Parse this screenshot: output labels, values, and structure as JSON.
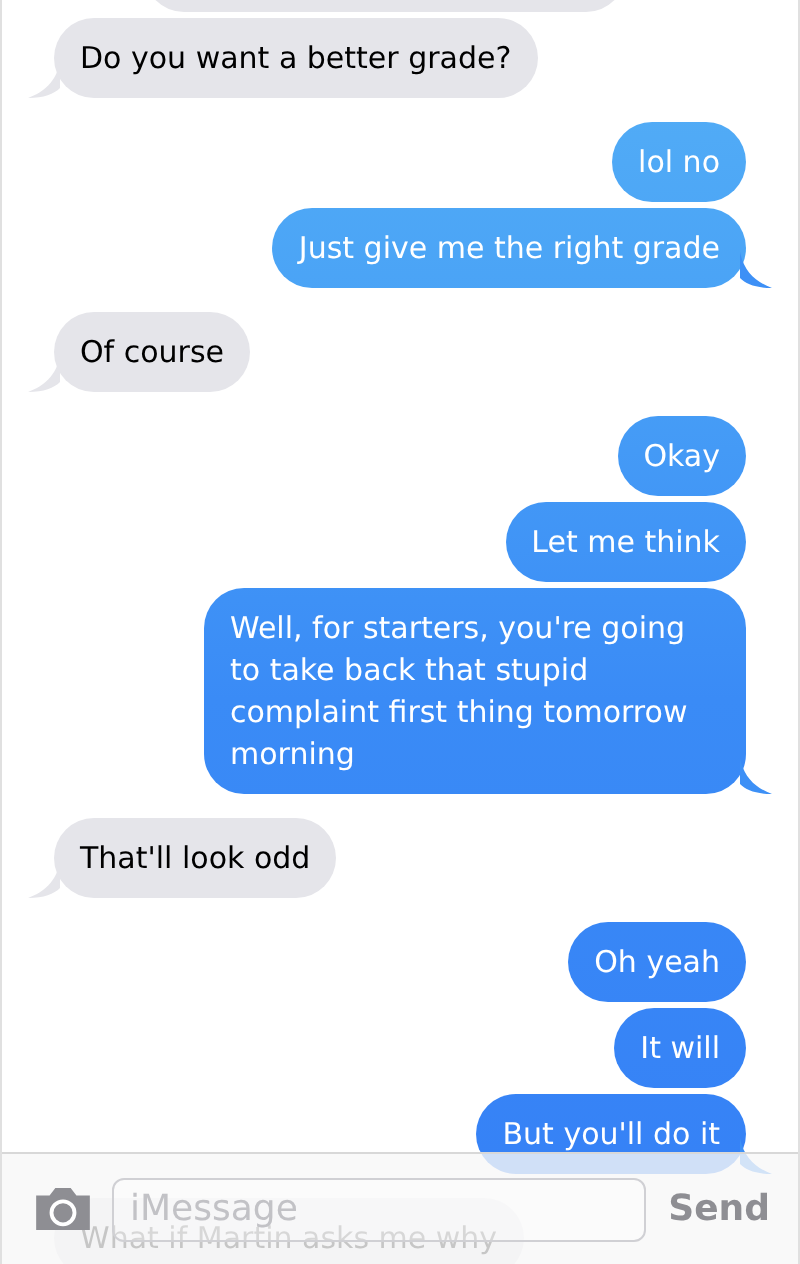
{
  "messages": [
    {
      "kind": "received",
      "tail": false
    },
    {
      "kind": "received",
      "text": "Do you want a better grade?",
      "tail": true
    },
    {
      "kind": "sent",
      "text": "lol no",
      "tail": false
    },
    {
      "kind": "sent",
      "text": "Just give me the right grade",
      "tail": true
    },
    {
      "kind": "received",
      "text": "Of course",
      "tail": true
    },
    {
      "kind": "sent",
      "text": "Okay",
      "tail": false
    },
    {
      "kind": "sent",
      "text": "Let me think",
      "tail": false
    },
    {
      "kind": "sent",
      "text": "Well, for starters, you're going to take back that stupid complaint first thing tomorrow morning",
      "tail": true
    },
    {
      "kind": "received",
      "text": "That'll look odd",
      "tail": true
    },
    {
      "kind": "sent",
      "text": "Oh yeah",
      "tail": false
    },
    {
      "kind": "sent",
      "text": "It will",
      "tail": false
    },
    {
      "kind": "sent",
      "text": "But you'll do it",
      "tail": true
    },
    {
      "kind": "received",
      "text": "What if Martin asks me why",
      "tail": false
    }
  ],
  "composer": {
    "placeholder": "iMessage",
    "send": "Send"
  }
}
